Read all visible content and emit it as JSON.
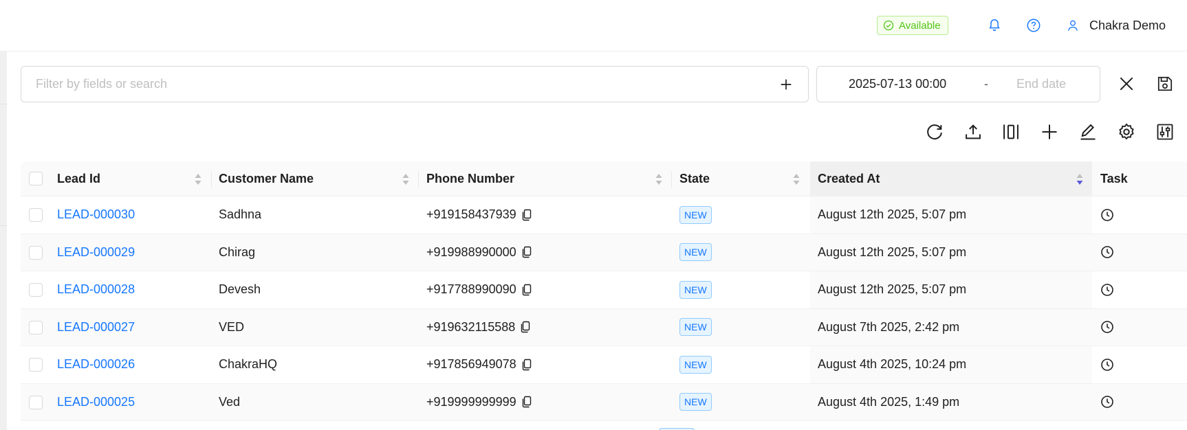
{
  "header": {
    "status_label": "Available",
    "status_color": "#52c41a",
    "user_name": "Chakra Demo"
  },
  "filter": {
    "placeholder": "Filter by fields or search",
    "date_start": "2025-07-13 00:00",
    "date_separator": "-",
    "date_end_placeholder": "End date"
  },
  "icons": {
    "accent": "#1677ff",
    "toolbar": [
      "refresh-icon",
      "upload-icon",
      "columns-icon",
      "plus-icon",
      "edit-icon",
      "settings-icon",
      "sliders-icon"
    ]
  },
  "table": {
    "columns": [
      "Lead Id",
      "Customer Name",
      "Phone Number",
      "State",
      "Created At",
      "Task"
    ],
    "sorted_column": "Created At",
    "sort_direction": "descending",
    "rows": [
      {
        "lead_id": "LEAD-000030",
        "customer": "Sadhna",
        "phone": "+919158437939",
        "state": "NEW",
        "created": "August 12th 2025, 5:07 pm"
      },
      {
        "lead_id": "LEAD-000029",
        "customer": "Chirag",
        "phone": "+919988990000",
        "state": "NEW",
        "created": "August 12th 2025, 5:07 pm"
      },
      {
        "lead_id": "LEAD-000028",
        "customer": "Devesh",
        "phone": "+917788990090",
        "state": "NEW",
        "created": "August 12th 2025, 5:07 pm"
      },
      {
        "lead_id": "LEAD-000027",
        "customer": "VED",
        "phone": "+919632115588",
        "state": "NEW",
        "created": "August 7th 2025, 2:42 pm"
      },
      {
        "lead_id": "LEAD-000026",
        "customer": "ChakraHQ",
        "phone": "+917856949078",
        "state": "NEW",
        "created": "August 4th 2025, 10:24 pm"
      },
      {
        "lead_id": "LEAD-000025",
        "customer": "Ved",
        "phone": "+919999999999",
        "state": "NEW",
        "created": "August 4th 2025, 1:49 pm"
      }
    ]
  }
}
